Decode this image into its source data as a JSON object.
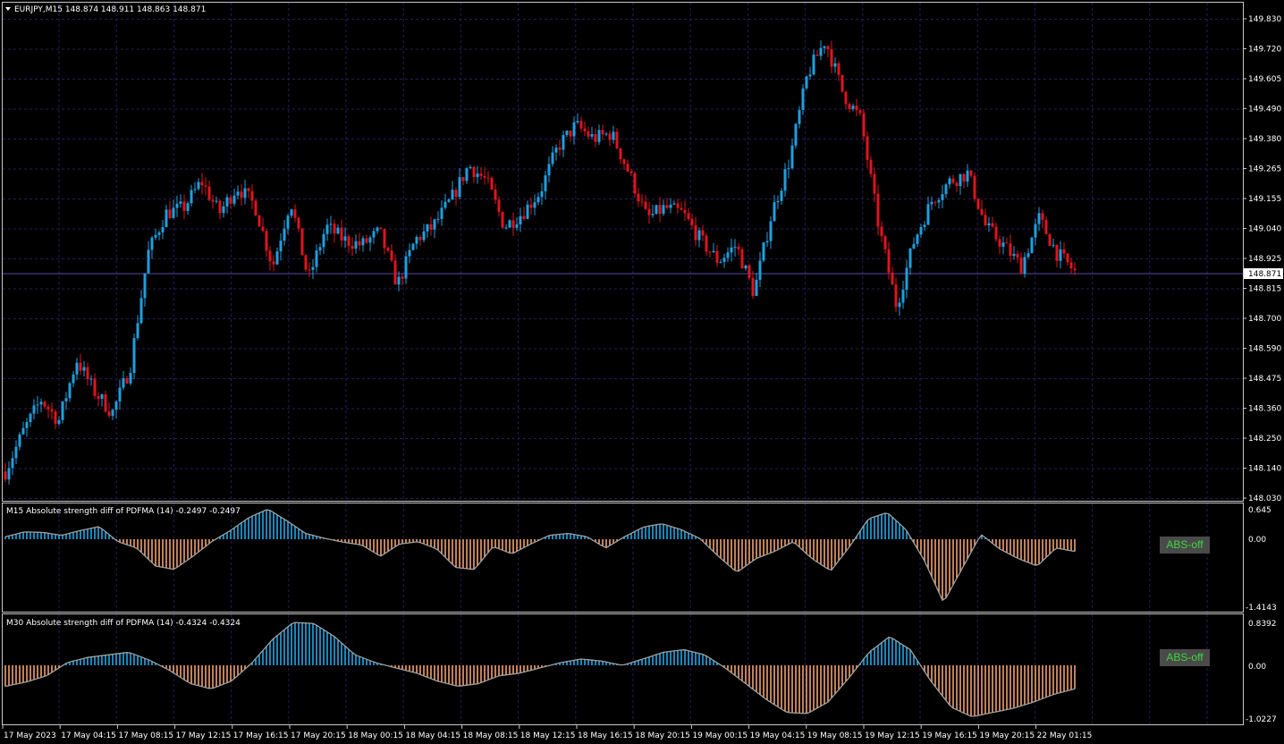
{
  "header": {
    "symbol_info": "EURJPY,M15  148.874 148.911 148.863 148.871"
  },
  "price_axis": {
    "ticks": [
      "149.830",
      "149.720",
      "149.605",
      "149.490",
      "149.380",
      "149.265",
      "149.155",
      "149.040",
      "148.925",
      "148.815",
      "148.700",
      "148.590",
      "148.475",
      "148.360",
      "148.250",
      "148.140",
      "148.030"
    ],
    "current_price": "148.871"
  },
  "indicator1": {
    "title": "M15 Absolute strength diff of PDFMA (14) -0.2497 -0.2497",
    "ticks": [
      "0.645",
      "0.00",
      "-1.4143"
    ],
    "button_label": "ABS-off"
  },
  "indicator2": {
    "title": "M30 Absolute strength diff of PDFMA (14) -0.4324 -0.4324",
    "ticks": [
      "0.8392",
      "0.00",
      "-1.0227"
    ],
    "button_label": "ABS-off"
  },
  "time_axis": {
    "labels": [
      "17 May 2023",
      "17 May 04:15",
      "17 May 08:15",
      "17 May 12:15",
      "17 May 16:15",
      "17 May 20:15",
      "18 May 00:15",
      "18 May 04:15",
      "18 May 08:15",
      "18 May 12:15",
      "18 May 16:15",
      "18 May 20:15",
      "19 May 00:15",
      "19 May 04:15",
      "19 May 08:15",
      "19 May 12:15",
      "19 May 16:15",
      "19 May 20:15",
      "22 May 01:15"
    ]
  },
  "colors": {
    "background": "#000000",
    "grid": "#2b1b5a",
    "bull": "#1e9fe0",
    "bear": "#e0141e",
    "hist_pos": "#20a8e8",
    "hist_neg": "#f0a070",
    "line": "#a0a0a0",
    "button_text": "#39d939",
    "button_bg": "#4a4a4a"
  },
  "chart_data": {
    "type": "candlestick",
    "symbol": "EURJPY",
    "timeframe": "M15",
    "ylim": [
      148.03,
      149.83
    ],
    "last_ohlc": {
      "open": 148.874,
      "high": 148.911,
      "low": 148.863,
      "close": 148.871
    },
    "close_path": [
      148.13,
      148.28,
      148.4,
      148.32,
      148.55,
      148.43,
      148.35,
      148.52,
      148.95,
      149.1,
      149.12,
      149.22,
      149.1,
      149.2,
      149.13,
      148.9,
      149.15,
      148.85,
      149.05,
      149.0,
      148.98,
      149.03,
      148.83,
      149.0,
      149.05,
      149.15,
      149.28,
      149.22,
      149.05,
      149.1,
      149.18,
      149.35,
      149.43,
      149.38,
      149.4,
      149.25,
      149.08,
      149.12,
      149.1,
      149.0,
      148.92,
      148.98,
      148.8,
      149.1,
      149.3,
      149.62,
      149.75,
      149.55,
      149.45,
      149.05,
      148.75,
      149.0,
      149.15,
      149.22,
      149.25,
      149.05,
      148.98,
      148.9,
      149.08,
      148.95,
      148.88
    ]
  },
  "indicator1_data": {
    "ylim": [
      -1.4143,
      0.645
    ],
    "path": [
      0.05,
      0.15,
      0.14,
      0.08,
      0.18,
      0.26,
      -0.05,
      -0.18,
      -0.55,
      -0.62,
      -0.35,
      -0.05,
      0.18,
      0.45,
      0.62,
      0.38,
      0.12,
      0.02,
      -0.06,
      -0.12,
      -0.35,
      -0.1,
      -0.05,
      -0.2,
      -0.58,
      -0.62,
      -0.15,
      -0.3,
      -0.1,
      0.08,
      0.12,
      0.05,
      -0.18,
      0.05,
      0.25,
      0.32,
      0.2,
      0.02,
      -0.35,
      -0.68,
      -0.4,
      -0.25,
      -0.05,
      -0.4,
      -0.65,
      -0.15,
      0.42,
      0.55,
      0.2,
      -0.45,
      -1.3,
      -0.6,
      0.1,
      -0.2,
      -0.4,
      -0.55,
      -0.18,
      -0.25
    ]
  },
  "indicator2_data": {
    "ylim": [
      -1.0227,
      0.8392
    ],
    "path": [
      -0.4,
      -0.32,
      -0.2,
      0.05,
      0.15,
      0.2,
      0.25,
      0.1,
      -0.1,
      -0.35,
      -0.45,
      -0.3,
      0.05,
      0.5,
      0.82,
      0.8,
      0.55,
      0.2,
      0.05,
      -0.05,
      -0.15,
      -0.3,
      -0.4,
      -0.35,
      -0.2,
      -0.15,
      -0.05,
      0.05,
      0.12,
      0.08,
      0.0,
      0.12,
      0.25,
      0.3,
      0.2,
      -0.05,
      -0.35,
      -0.65,
      -0.9,
      -0.92,
      -0.7,
      -0.25,
      0.25,
      0.55,
      0.3,
      -0.3,
      -0.8,
      -0.98,
      -0.9,
      -0.82,
      -0.7,
      -0.55,
      -0.45
    ]
  }
}
